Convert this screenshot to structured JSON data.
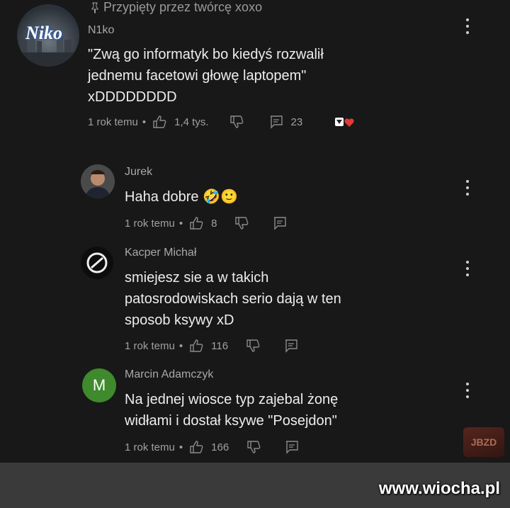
{
  "pinned_label": "Przypięty przez twórcę xoxo",
  "top_comment": {
    "avatar_text": "Niko",
    "author": "N1ko",
    "text_lines": [
      "\"Zwą go informatyk bo kiedyś rozwalił",
      "jednemu facetowi głowę laptopem\"",
      "xDDDDDDDD"
    ],
    "time": "1 rok temu",
    "likes": "1,4 tys.",
    "replies_count": "23"
  },
  "replies": [
    {
      "author": "Jurek",
      "text_lines": [
        "Haha dobre 🤣🙂"
      ],
      "time": "1 rok temu",
      "likes": "8"
    },
    {
      "author": "Kacper Michał",
      "text_lines": [
        "smiejesz sie a w takich",
        "patosrodowiskach serio dają w ten",
        "sposob ksywy xD"
      ],
      "time": "1 rok temu",
      "likes": "116"
    },
    {
      "author": "Marcin Adamczyk",
      "avatar_letter": "M",
      "text_lines": [
        "Na jednej wiosce typ zajebal żonę",
        "widłami i dostał ksywe \"Posejdon\""
      ],
      "time": "1 rok temu",
      "likes": "166"
    }
  ],
  "meta_separator": "•",
  "watermark": "www.wiocha.pl",
  "jbzd_logo": "JBZD",
  "colors": {
    "background": "#181818",
    "marcin_avatar": "#3f8a2c",
    "heart": "#e53935"
  }
}
